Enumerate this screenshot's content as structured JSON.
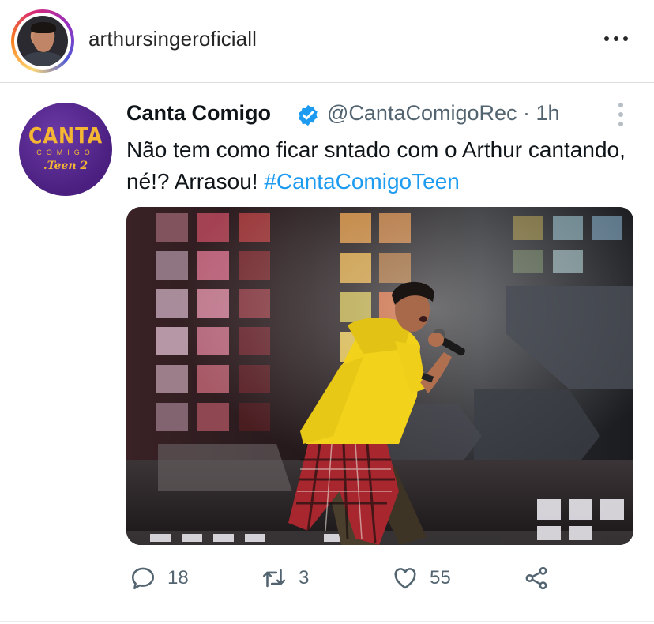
{
  "instagram": {
    "username": "arthursingeroficiall"
  },
  "tweet": {
    "display_name": "Canta Comigo",
    "handle_time": "@CantaComigoRec · 1h",
    "text": "Não tem como ficar sntado com o Arthur cantando, né!? Arrasou! ",
    "hashtag": "#CantaComigoTeen",
    "avatar_logo": {
      "line1": "CANTA",
      "line2": "COMIGO",
      "line3": ".Teen 2"
    },
    "verified_icon": "verified-badge-icon",
    "actions": {
      "replies": "18",
      "retweets": "3",
      "likes": "55"
    }
  },
  "colors": {
    "link": "#1d9bf0",
    "secondary_text": "#536471",
    "logo_purple": "#4a1f7f",
    "logo_gold": "#f5b733",
    "hoodie_yellow": "#f2d21a"
  }
}
